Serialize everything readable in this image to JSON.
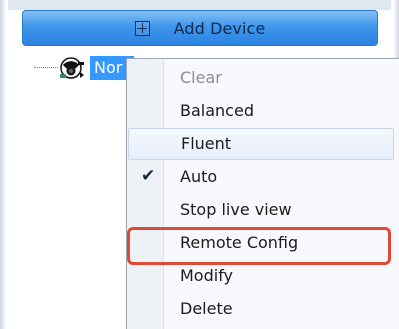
{
  "toolbar": {
    "add_device_label": "Add Device",
    "add_icon": "plus-box-icon"
  },
  "tree": {
    "device_name": "Nor",
    "device_icon": "camera-device-icon"
  },
  "context_menu": {
    "items": [
      {
        "label": "Clear",
        "enabled": false,
        "checked": false
      },
      {
        "label": "Balanced",
        "enabled": true,
        "checked": false
      },
      {
        "label": "Fluent",
        "enabled": true,
        "checked": false,
        "hovered": true
      },
      {
        "label": "Auto",
        "enabled": true,
        "checked": true
      },
      {
        "label": "Stop live view",
        "enabled": true,
        "checked": false
      },
      {
        "label": "Remote Config",
        "enabled": true,
        "checked": false,
        "highlighted": true
      },
      {
        "label": "Modify",
        "enabled": true,
        "checked": false
      },
      {
        "label": "Delete",
        "enabled": true,
        "checked": false
      }
    ],
    "check_icon": "checkmark-icon"
  },
  "colors": {
    "selection_blue": "#3399ff",
    "toolbar_blue": "#2a82e0",
    "highlight_red": "#de4a36"
  }
}
